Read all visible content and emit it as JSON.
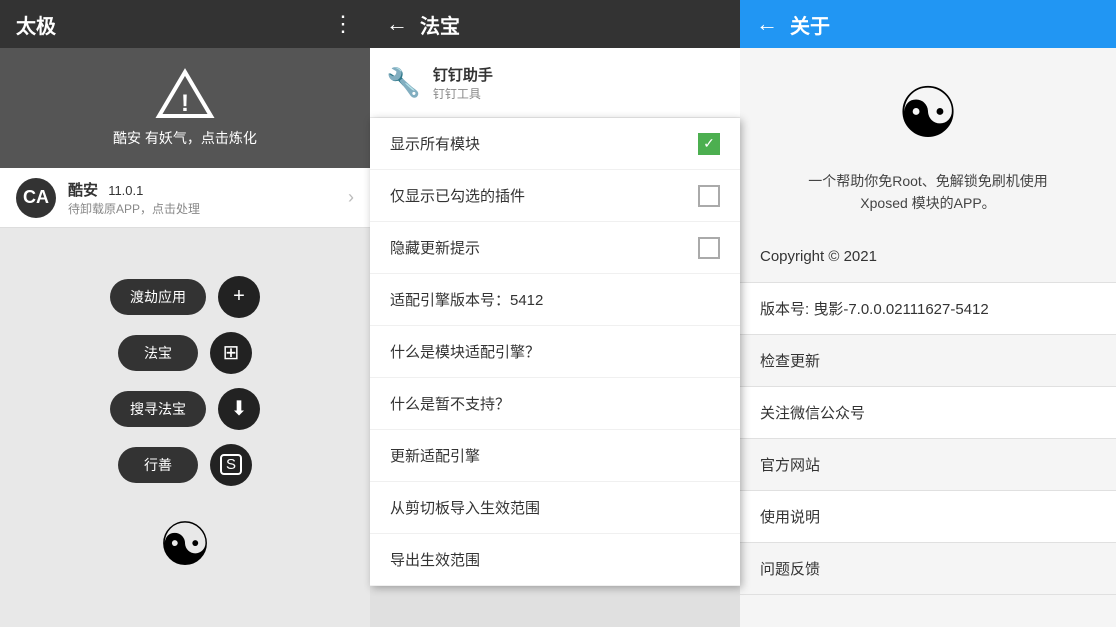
{
  "left": {
    "title": "太极",
    "warning_text": "酷安 有妖气，点击炼化",
    "app_name": "酷安",
    "app_version": "11.0.1",
    "app_subtitle": "待卸载原APP，点击处理",
    "buttons": [
      {
        "label": "渡劫应用",
        "icon": "+"
      },
      {
        "label": "法宝",
        "icon": "⊞"
      },
      {
        "label": "搜寻法宝",
        "icon": "⬇"
      },
      {
        "label": "行善",
        "icon": "S"
      }
    ]
  },
  "middle": {
    "back_icon": "←",
    "title": "法宝",
    "tool_name": "钉钉助手",
    "tool_sub": "钉钉工具",
    "menu_items": [
      {
        "label": "显示所有模块",
        "type": "checkbox",
        "checked": true
      },
      {
        "label": "仅显示已勾选的插件",
        "type": "checkbox",
        "checked": false
      },
      {
        "label": "隐藏更新提示",
        "type": "checkbox",
        "checked": false
      },
      {
        "label": "适配引擎版本号：5412",
        "type": "text"
      },
      {
        "label": "什么是模块适配引擎？",
        "type": "text"
      },
      {
        "label": "什么是暂不支持？",
        "type": "text"
      },
      {
        "label": "更新适配引擎",
        "type": "text"
      },
      {
        "label": "从剪切板导入生效范围",
        "type": "text"
      },
      {
        "label": "导出生效范围",
        "type": "text"
      }
    ]
  },
  "right": {
    "back_icon": "←",
    "title": "关于",
    "description": "一个帮助你免Root、免解锁免刷机使用\nXposed 模块的APP。",
    "copyright": "Copyright © 2021",
    "version": "版本号: 曳影-7.0.0.02111627-5412",
    "items": [
      "检查更新",
      "关注微信公众号",
      "官方网站",
      "使用说明",
      "问题反馈"
    ]
  }
}
